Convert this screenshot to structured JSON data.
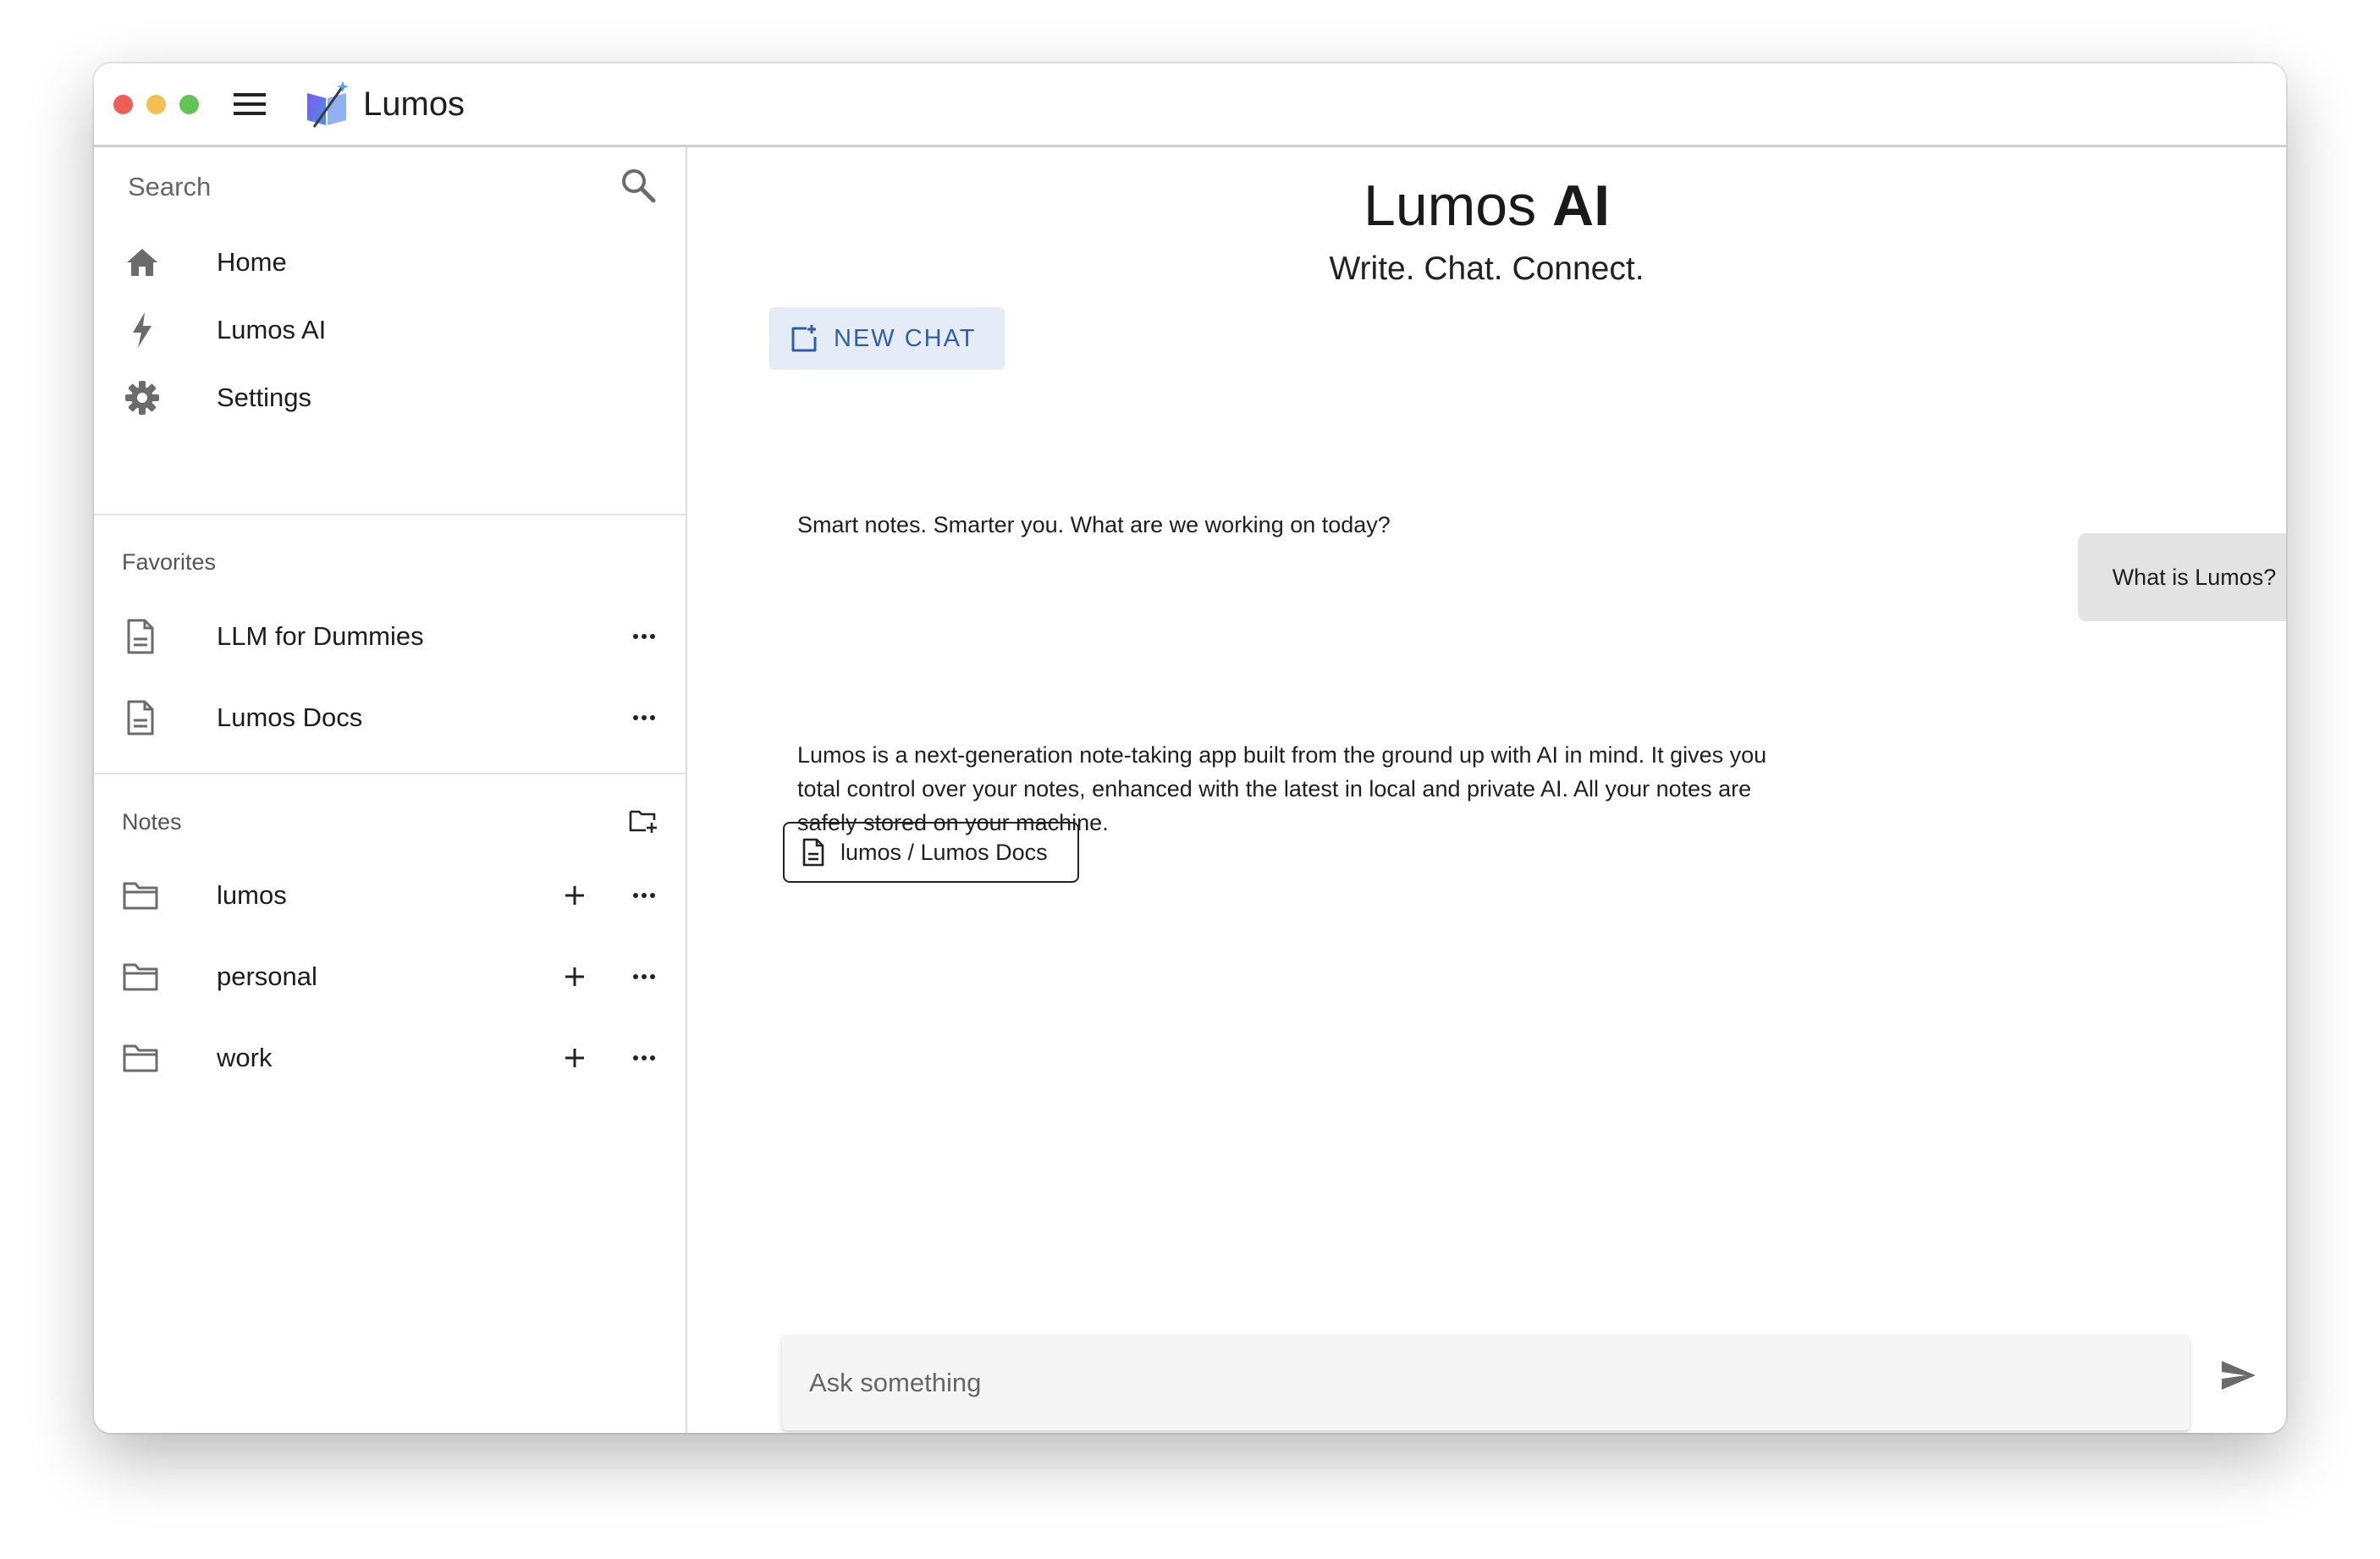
{
  "app": {
    "title": "Lumos",
    "icons": {
      "menu": "hamburger-menu-icon",
      "logo": "lumos-logo-book-wand"
    }
  },
  "sidebar": {
    "search_placeholder": "Search",
    "nav": [
      {
        "label": "Home",
        "icon": "home-icon"
      },
      {
        "label": "Lumos AI",
        "icon": "bolt-icon"
      },
      {
        "label": "Settings",
        "icon": "gear-icon"
      }
    ],
    "favorites": {
      "label": "Favorites",
      "items": [
        {
          "label": "LLM for Dummies",
          "icon": "document-icon"
        },
        {
          "label": "Lumos Docs",
          "icon": "document-icon"
        }
      ]
    },
    "notes": {
      "label": "Notes",
      "folders": [
        {
          "label": "lumos",
          "icon": "folder-icon"
        },
        {
          "label": "personal",
          "icon": "folder-icon"
        },
        {
          "label": "work",
          "icon": "folder-icon"
        }
      ]
    }
  },
  "main": {
    "title_prefix": "Lumos ",
    "title_bold": "AI",
    "tagline": "Write. Chat. Connect.",
    "new_chat_label": "NEW CHAT",
    "messages": {
      "greeting": "Smart notes. Smarter you. What are we working on today?",
      "user_question": "What is Lumos?",
      "answer_lines": [
        "Lumos is a next-generation note-taking app built from the ground up with AI in mind. It gives you",
        "total control over your notes, enhanced with the latest in local and private AI. All your notes are",
        "safely stored on your machine."
      ],
      "source": "lumos / Lumos Docs"
    },
    "ask_placeholder": "Ask something"
  },
  "colors": {
    "accent": "#2f5fa8",
    "new_chat_bg": "#e6ecf7",
    "user_bubble": "#e3e3e3",
    "icon_gray": "#6b6b6b"
  }
}
